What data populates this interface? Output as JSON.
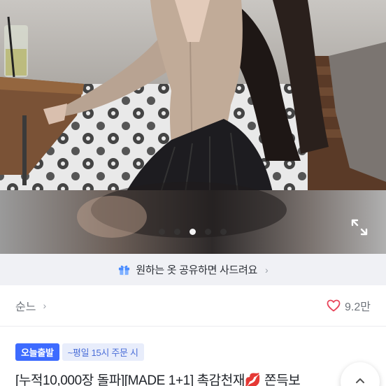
{
  "carousel": {
    "dot_count": 5,
    "active_index": 2
  },
  "share_banner": {
    "text": "원하는 옷 공유하면 사드려요",
    "chevron": "›",
    "icon": "gift-icon"
  },
  "seller": {
    "name": "순느",
    "chevron": "›"
  },
  "likes": {
    "count": "9.2만",
    "icon": "heart-outline-icon"
  },
  "badges": {
    "primary": "오늘출발",
    "secondary": "~평일 15시 주문 시"
  },
  "product": {
    "title": "[누적10,000장 돌파][MADE 1+1] 촉감천재💋 쫀득보"
  },
  "colors": {
    "badge_blue": "#3d6bff",
    "heart": "#e8445a",
    "banner_bg": "#f0f1f5"
  }
}
